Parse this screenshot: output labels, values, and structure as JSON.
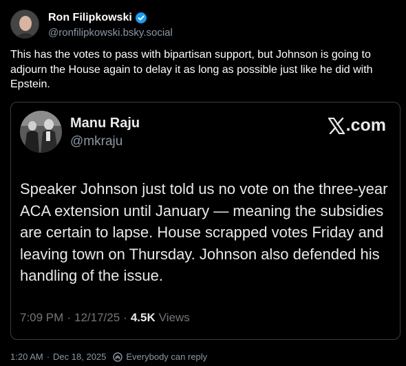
{
  "post": {
    "author": {
      "display_name": "Ron Filipkowski",
      "handle": "@ronfilipkowski.bsky.social",
      "verified": true,
      "verified_color": "#1d9bf0",
      "avatar_icon": "profile-photo"
    },
    "text": "This has the votes to pass with bipartisan support, but Johnson is going to adjourn the House again to delay it as long as possible just like he did with Epstein.",
    "timestamp": "1:20 AM",
    "date": "Dec 18, 2025",
    "reply_setting": "Everybody can reply",
    "reply_icon": "reply-settings-icon"
  },
  "embed": {
    "author": {
      "display_name": "Manu Raju",
      "handle": "@mkraju",
      "avatar_icon": "profile-photo"
    },
    "source_label": ".com",
    "source_icon": "x-logo-icon",
    "text": "Speaker Johnson just told us no vote on the three-year ACA extension until January — meaning the subsidies are certain to lapse. House scrapped votes Friday and leaving town on Thursday. Johnson also defended his handling of the issue.",
    "time": "7:09 PM",
    "date": "12/17/25",
    "views_count": "4.5K",
    "views_label": "Views"
  },
  "colors": {
    "background": "#000000",
    "text_primary": "#ffffff",
    "text_secondary": "#8b98a5",
    "card_border": "#3a3d42"
  }
}
